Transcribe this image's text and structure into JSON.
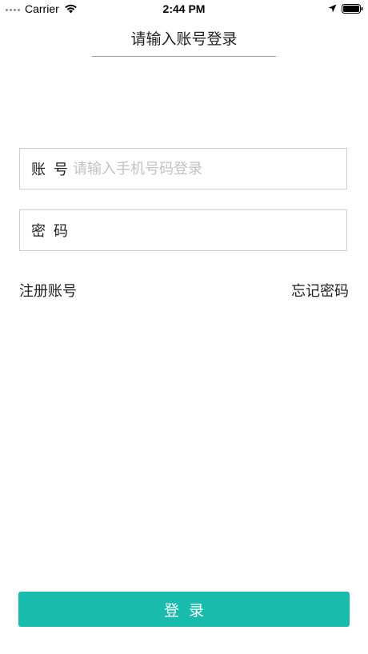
{
  "status_bar": {
    "carrier": "Carrier",
    "time": "2:44 PM",
    "icons": [
      "signal-dots-icon",
      "wifi-icon",
      "location-arrow-icon",
      "battery-icon"
    ]
  },
  "header": {
    "title": "请输入账号登录"
  },
  "form": {
    "account": {
      "label": "账号",
      "placeholder": "请输入手机号码登录",
      "value": ""
    },
    "password": {
      "label": "密码",
      "placeholder": "",
      "value": ""
    }
  },
  "links": {
    "register": "注册账号",
    "forgot_password": "忘记密码"
  },
  "login_button": {
    "label": "登录"
  },
  "colors": {
    "accent": "#19bcac",
    "border": "#cfcfcf",
    "placeholder": "#c2c2c2",
    "text": "#222222"
  }
}
